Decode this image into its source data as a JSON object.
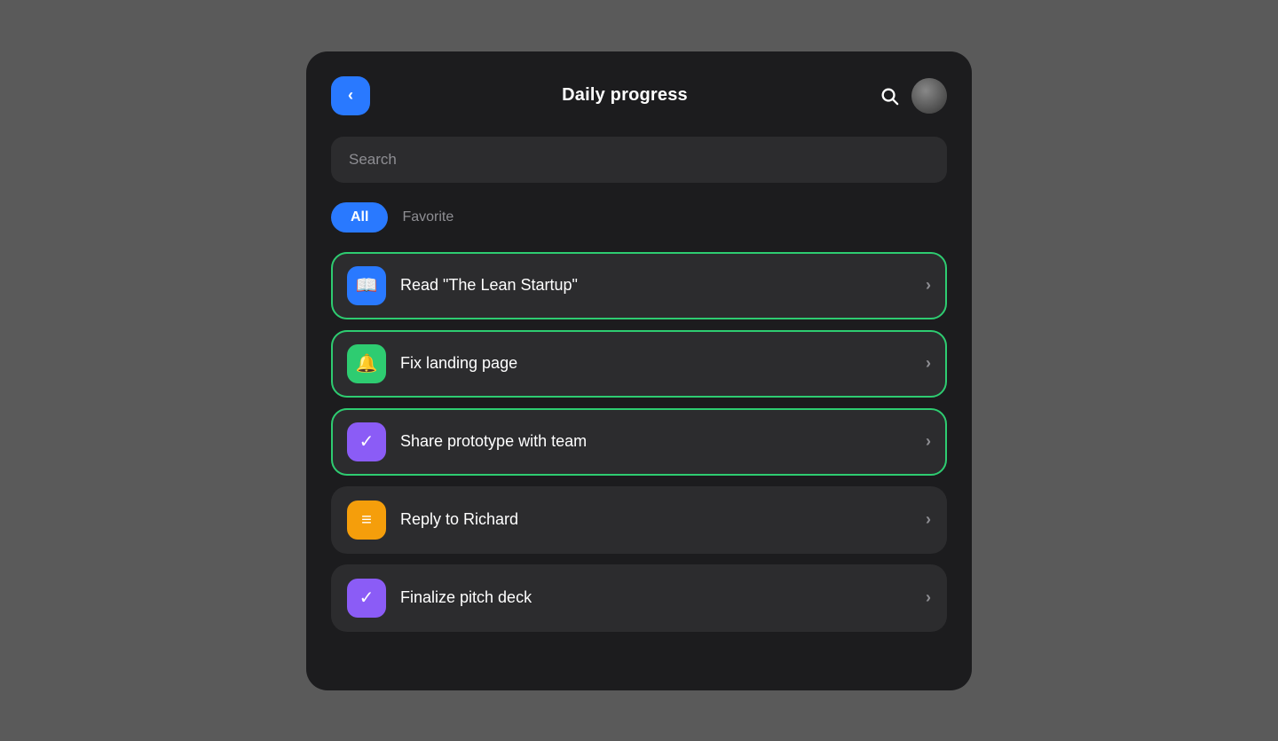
{
  "header": {
    "back_label": "‹",
    "title": "Daily progress",
    "search_aria": "Search",
    "avatar_aria": "User avatar"
  },
  "search": {
    "placeholder": "Search"
  },
  "filters": {
    "all_label": "All",
    "favorite_label": "Favorite"
  },
  "tasks": [
    {
      "id": "task-1",
      "label": "Read \"The Lean Startup\"",
      "icon": "📖",
      "icon_color": "blue",
      "green_border": true,
      "chevron": "›"
    },
    {
      "id": "task-2",
      "label": "Fix landing page",
      "icon": "🔔",
      "icon_color": "green",
      "green_border": true,
      "chevron": "›"
    },
    {
      "id": "task-3",
      "label": "Share prototype with team",
      "icon": "✓",
      "icon_color": "purple",
      "green_border": true,
      "chevron": "›"
    },
    {
      "id": "task-4",
      "label": "Reply to Richard",
      "icon": "≡",
      "icon_color": "orange",
      "green_border": false,
      "chevron": "›"
    },
    {
      "id": "task-5",
      "label": "Finalize pitch deck",
      "icon": "✓",
      "icon_color": "purple",
      "green_border": false,
      "chevron": "›"
    }
  ]
}
